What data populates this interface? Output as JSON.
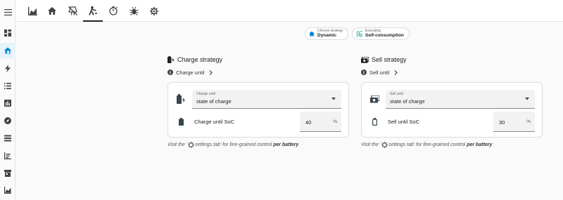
{
  "sidebar": {
    "items": [
      {
        "icon": "dashboard-icon"
      },
      {
        "icon": "home-battery-icon",
        "active": true
      },
      {
        "icon": "lightning-icon"
      },
      {
        "icon": "list-icon"
      },
      {
        "icon": "bar-chart-icon"
      },
      {
        "icon": "compass-icon"
      },
      {
        "icon": "stack-icon"
      },
      {
        "icon": "chart-icon"
      },
      {
        "icon": "store-icon"
      },
      {
        "icon": "area-chart-icon"
      }
    ]
  },
  "toolbar": {
    "tabs": [
      {
        "icon": "area-chart-icon"
      },
      {
        "icon": "home-icon"
      },
      {
        "icon": "solar-off-icon"
      },
      {
        "icon": "walker-icon",
        "active": true
      },
      {
        "icon": "timer-icon"
      },
      {
        "icon": "bug-icon"
      },
      {
        "icon": "gear-icon"
      }
    ]
  },
  "status": {
    "strategy_label": "Choose strategy",
    "strategy_value": "Dynamic",
    "executing_label": "Executing",
    "executing_value": "Self-consumption"
  },
  "charge": {
    "title": "Charge strategy",
    "sub": "Charge until",
    "select_label": "Charge until",
    "select_value": "state of charge",
    "soc_label": "Charge until SoC",
    "soc_value": "40",
    "unit": "%"
  },
  "sell": {
    "title": "Sell strategy",
    "sub": "Sell until",
    "select_label": "Sell until",
    "select_value": "state of charge",
    "soc_label": "Sell until SoC",
    "soc_value": "30",
    "unit": "%"
  },
  "hint": {
    "prefix": "Visit the '",
    "middle": "settings tab' for fine-grained control",
    "bold": "per battery"
  },
  "colors": {
    "accent": "#0288d1",
    "icon": "#424242"
  }
}
